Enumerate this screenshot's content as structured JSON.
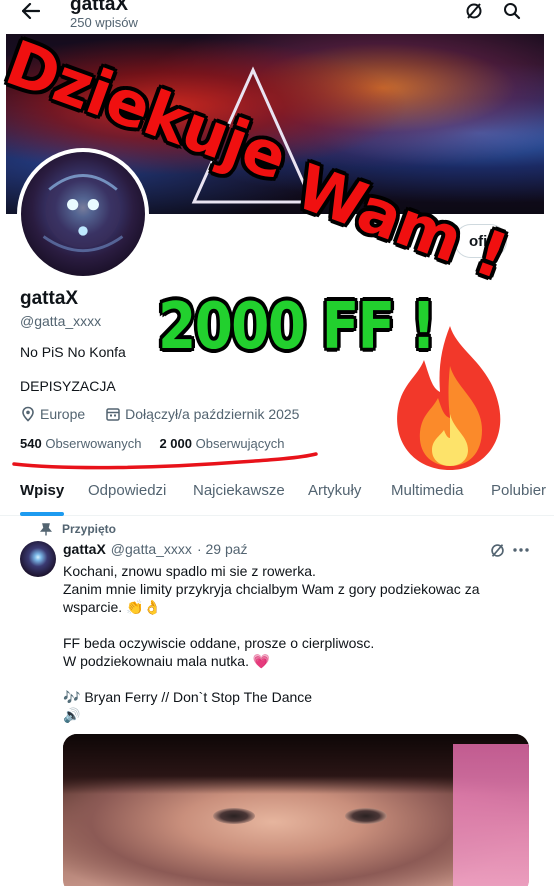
{
  "header": {
    "title": "gattaX",
    "post_count": "250 wpisów"
  },
  "profile": {
    "name": "gattaX",
    "handle": "@gatta_xxxx",
    "bio_line1": "No PiS No Konfa",
    "bio_line2": "DEPISYZACJA",
    "location": "Europe",
    "joined": "Dołączył/a październik 2025",
    "following_count": "540",
    "following_label": "Obserwowanych",
    "followers_count": "2 000",
    "followers_label": "Obserwujących",
    "profile_button_label": "ofil"
  },
  "tabs": [
    {
      "label": "Wpisy"
    },
    {
      "label": "Odpowiedzi"
    },
    {
      "label": "Najciekawsze"
    },
    {
      "label": "Artykuły"
    },
    {
      "label": "Multimedia"
    },
    {
      "label": "Polubier"
    }
  ],
  "post": {
    "pinned_label": "Przypięto",
    "author": "gattaX",
    "handle": "@gatta_xxxx",
    "date": "· 29 paź",
    "lines": [
      "Kochani, znowu spadlo mi sie z rowerka.",
      "Zanim mnie limity przykryja chcialbym Wam z gory podziekowac za",
      "wsparcie. 👏👌",
      "FF beda oczywiscie oddane, prosze o cierpliwosc.",
      "W podziekownaiu mala nutka. 💗",
      "🎶 Bryan Ferry // Don`t Stop The Dance",
      "🔊"
    ]
  },
  "overlay": {
    "thanks_part1": "Dziekuje",
    "thanks_part2": "Wam !",
    "ff_text": "2000 FF !"
  },
  "colors": {
    "accent": "#1d9bf0",
    "overlay_red": "#f01010",
    "overlay_green": "#22d02e",
    "muted_text": "#536471"
  },
  "icons": [
    "back-arrow-icon",
    "grok-icon",
    "search-icon",
    "location-icon",
    "calendar-icon",
    "pin-icon",
    "more-icon",
    "fire-emoji"
  ]
}
